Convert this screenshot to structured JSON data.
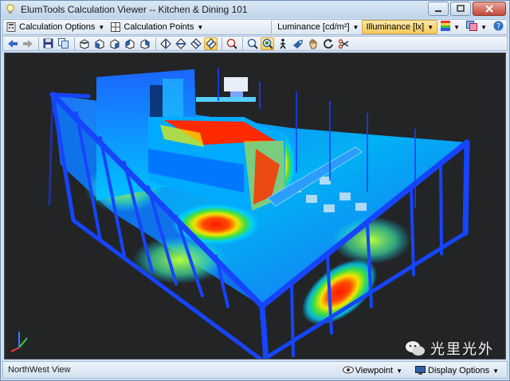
{
  "window": {
    "title": "ElumTools Calculation Viewer -- Kitchen & Dining 101",
    "icon": "lightbulb-icon"
  },
  "toolbar1": {
    "calc_options": "Calculation Options",
    "calc_points": "Calculation Points",
    "luminance": "Luminance [cd/m²]",
    "illuminance": "Illuminance [lx]"
  },
  "viewport": {
    "watermark": "光里光外"
  },
  "status": {
    "view_name": "NorthWest View",
    "viewpoint_label": "Viewpoint",
    "display_options_label": "Display Options"
  },
  "colors": {
    "accent_active": "#f6c95b",
    "viewport_bg": "#232426",
    "false_color_low": "#0000ff",
    "false_color_high": "#ff2000"
  }
}
